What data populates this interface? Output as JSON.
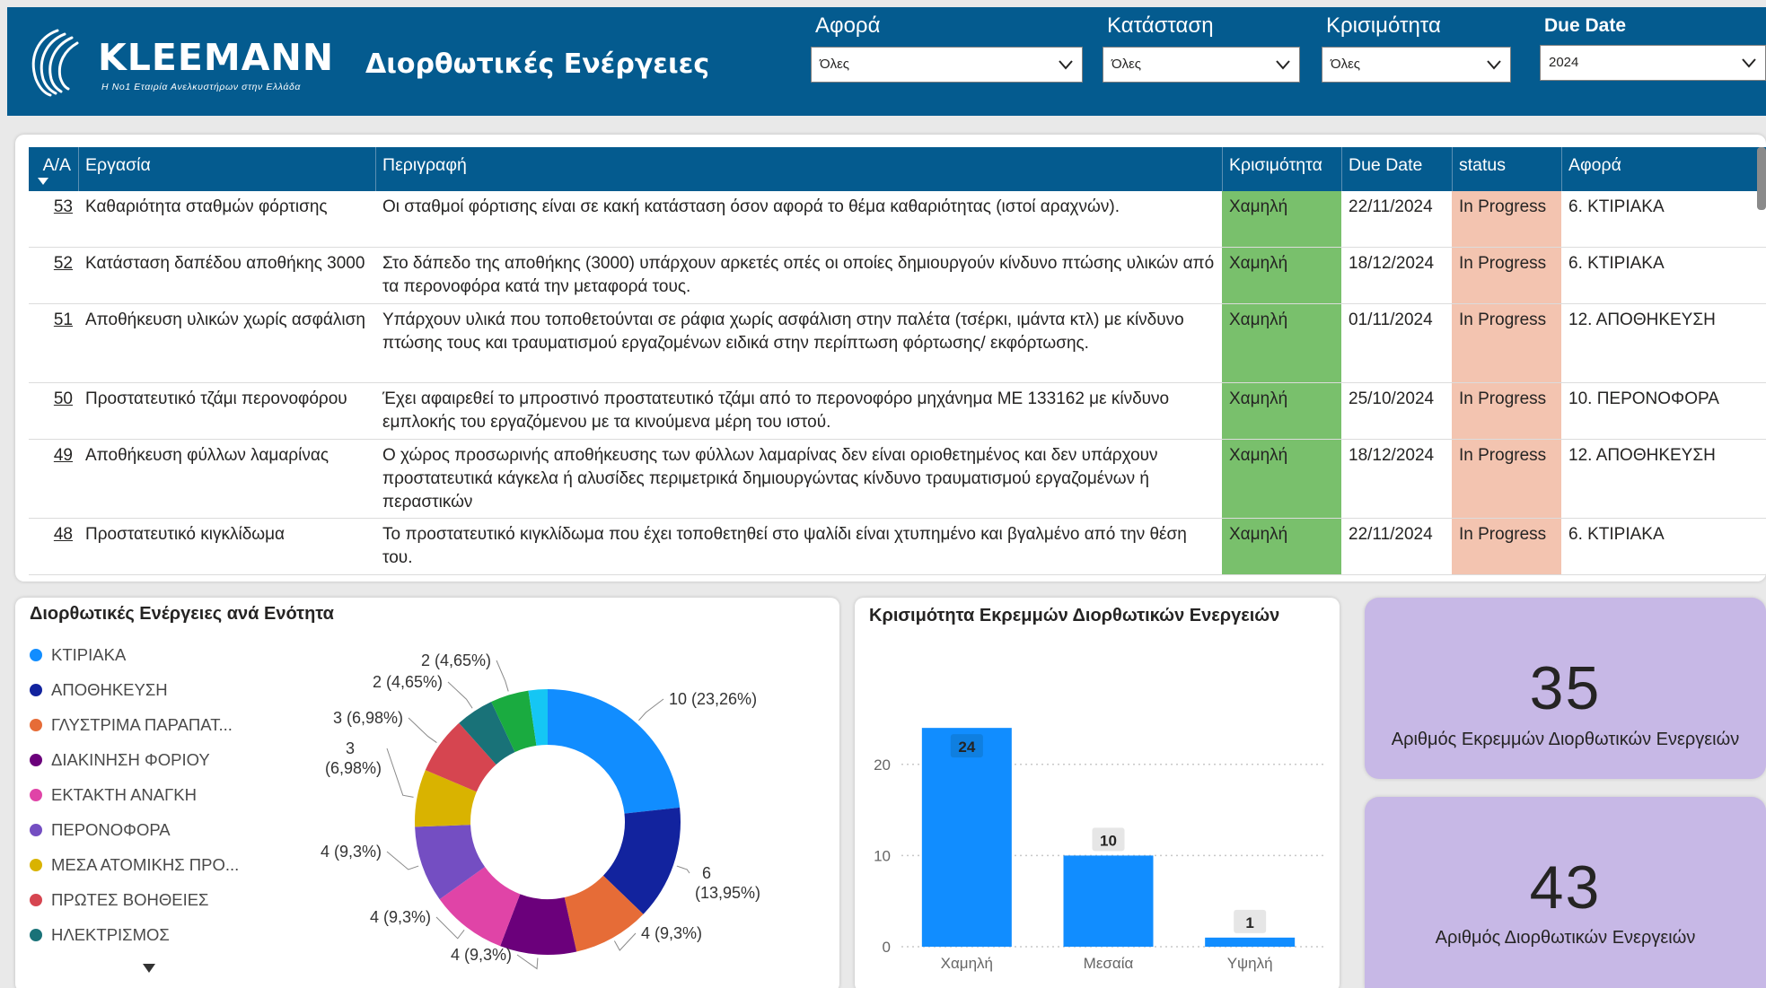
{
  "header": {
    "brand": "KLEEMANN",
    "tagline": "Η No1 Εταιρία Ανελκυστήρων στην Ελλάδα",
    "title": "Διορθωτικές Ενέργειες",
    "bg_color": "#045b8f"
  },
  "filters": [
    {
      "label": "Αφορά",
      "value": "Όλες"
    },
    {
      "label": "Κατάσταση",
      "value": "Όλες"
    },
    {
      "label": "Κρισιμότητα",
      "value": "Όλες"
    },
    {
      "label": "Due Date",
      "value": "2024"
    }
  ],
  "table": {
    "columns": [
      "A/A",
      "Εργασία",
      "Περιγραφή",
      "Κρισιμότητα",
      "Due Date",
      "status",
      "Αφορά"
    ],
    "rows": [
      {
        "aa": "53",
        "task": "Καθαριότητα σταθμών φόρτισης",
        "desc": "Οι σταθμοί φόρτισης είναι σε κακή κατάσταση όσον αφορά το θέμα καθαριότητας (ιστοί αραχνών).",
        "crit": "Χαμηλή",
        "due": "22/11/2024",
        "status": "In Progress",
        "about": "6. ΚΤΙΡΙΑΚΑ"
      },
      {
        "aa": "52",
        "task": "Κατάσταση δαπέδου αποθήκης 3000",
        "desc": "Στο δάπεδο της αποθήκης (3000) υπάρχουν αρκετές οπές οι οποίες δημιουργούν κίνδυνο πτώσης υλικών από τα περονοφόρα κατά την μεταφορά τους.",
        "crit": "Χαμηλή",
        "due": "18/12/2024",
        "status": "In Progress",
        "about": "6. ΚΤΙΡΙΑΚΑ"
      },
      {
        "aa": "51",
        "task": "Αποθήκευση υλικών χωρίς ασφάλιση",
        "desc": "Υπάρχουν υλικά που τοποθετούνται σε ράφια χωρίς ασφάλιση στην παλέτα (τσέρκι, ιμάντα κτλ) με κίνδυνο πτώσης τους και τραυματισμού εργαζομένων ειδικά στην περίπτωση φόρτωσης/ εκφόρτωσης.",
        "crit": "Χαμηλή",
        "due": "01/11/2024",
        "status": "In Progress",
        "about": "12. ΑΠΟΘΗΚΕΥΣΗ"
      },
      {
        "aa": "50",
        "task": "Προστατευτικό τζάμι περονοφόρου",
        "desc": "Έχει αφαιρεθεί το μπροστινό προστατευτικό τζάμι από το περονοφόρο μηχάνημα ΜΕ 133162 με κίνδυνο εμπλοκής του εργαζόμενου με τα κινούμενα μέρη του ιστού.",
        "crit": "Χαμηλή",
        "due": "25/10/2024",
        "status": "In Progress",
        "about": "10. ΠΕΡΟΝΟΦΟΡΑ"
      },
      {
        "aa": "49",
        "task": "Αποθήκευση φύλλων λαμαρίνας",
        "desc": "Ο χώρος προσωρινής αποθήκευσης των φύλλων λαμαρίνας δεν είναι οριοθετημένος και δεν υπάρχουν προστατευτικά κάγκελα ή αλυσίδες περιμετρικά δημιουργώντας κίνδυνο τραυματισμού εργαζομένων ή περαστικών",
        "crit": "Χαμηλή",
        "due": "18/12/2024",
        "status": "In Progress",
        "about": "12. ΑΠΟΘΗΚΕΥΣΗ"
      },
      {
        "aa": "48",
        "task": "Προστατευτικό κιγκλίδωμα",
        "desc": "Το προστατευτικό κιγκλίδωμα που έχει τοποθετηθεί στο ψαλίδι είναι χτυπημένο και βγαλμένο από την θέση του.",
        "crit": "Χαμηλή",
        "due": "22/11/2024",
        "status": "In Progress",
        "about": "6. ΚΤΙΡΙΑΚΑ"
      }
    ],
    "crit_color": "#79c06c",
    "status_color": "#f3c4b0"
  },
  "donut": {
    "title": "Διορθωτικές Ενέργειες ανά Ενότητα",
    "legend": [
      {
        "label": "ΚΤΙΡΙΑΚΑ",
        "color": "#118dff"
      },
      {
        "label": "ΑΠΟΘΗΚΕΥΣΗ",
        "color": "#12239e"
      },
      {
        "label": "ΓΛΥΣΤΡΙΜΑ ΠΑΡΑΠΑΤ...",
        "color": "#e66c37"
      },
      {
        "label": "ΔΙΑΚΙΝΗΣΗ ΦΟΡΙΟΥ",
        "color": "#6b007b"
      },
      {
        "label": "ΕΚΤΑΚΤΗ ΑΝΑΓΚΗ",
        "color": "#e044a7"
      },
      {
        "label": "ΠΕΡΟΝΟΦΟΡΑ",
        "color": "#744ec2"
      },
      {
        "label": "ΜΕΣΑ ΑΤΟΜΙΚΗΣ ΠΡΟ...",
        "color": "#d9b300"
      },
      {
        "label": "ΠΡΩΤΕΣ ΒΟΗΘΕΙΕΣ",
        "color": "#d64550"
      },
      {
        "label": "ΗΛΕΚΤΡΙΣΜΟΣ",
        "color": "#197278"
      }
    ]
  },
  "bar": {
    "title": "Κρισιμότητα Εκρεμμών Διορθωτικών Ενεργειών"
  },
  "chart_data": [
    {
      "type": "pie",
      "title": "Διορθωτικές Ενέργειες ανά Ενότητα",
      "slices": [
        {
          "label": "ΚΤΙΡΙΑΚΑ",
          "value": 10,
          "text": "10 (23,26%)",
          "color": "#118dff"
        },
        {
          "label": "ΑΠΟΘΗΚΕΥΣΗ",
          "value": 6,
          "text": "6 (13,95%)",
          "color": "#12239e"
        },
        {
          "label": "ΓΛΥΣΤΡΙΜΑ ΠΑΡΑΠΑΤ...",
          "value": 4,
          "text": "4 (9,3%)",
          "color": "#e66c37"
        },
        {
          "label": "ΔΙΑΚΙΝΗΣΗ ΦΟΡΙΟΥ",
          "value": 4,
          "text": "4 (9,3%)",
          "color": "#6b007b"
        },
        {
          "label": "ΕΚΤΑΚΤΗ ΑΝΑΓΚΗ",
          "value": 4,
          "text": "4 (9,3%)",
          "color": "#e044a7"
        },
        {
          "label": "ΠΕΡΟΝΟΦΟΡΑ",
          "value": 4,
          "text": "4 (9,3%)",
          "color": "#744ec2"
        },
        {
          "label": "ΜΕΣΑ ΑΤΟΜΙΚΗΣ ΠΡΟ...",
          "value": 3,
          "text": "3 (6,98%)",
          "color": "#d9b300"
        },
        {
          "label": "ΠΡΩΤΕΣ ΒΟΗΘΕΙΕΣ",
          "value": 3,
          "text": "3 (6,98%)",
          "color": "#d64550"
        },
        {
          "label": "ΗΛΕΚΤΡΙΣΜΟΣ",
          "value": 2,
          "text": "2 (4,65%)",
          "color": "#197278"
        },
        {
          "label": "",
          "value": 2,
          "text": "2 (4,65%)",
          "color": "#1aab40"
        },
        {
          "label": "",
          "value": 1,
          "text": "",
          "color": "#15c6f4"
        }
      ]
    },
    {
      "type": "bar",
      "title": "Κρισιμότητα Εκρεμμών Διορθωτικών Ενεργειών",
      "categories": [
        "Χαμηλή",
        "Μεσαία",
        "Υψηλή"
      ],
      "values": [
        24,
        10,
        1
      ],
      "yticks": [
        0,
        10,
        20
      ],
      "ylim": [
        0,
        25
      ],
      "grid": true,
      "color": "#118dff"
    }
  ],
  "kpis": [
    {
      "value": "35",
      "label": "Αριθμός Εκρεμμών Διορθωτικών Ενεργειών"
    },
    {
      "value": "43",
      "label": "Αριθμός Διορθωτικών Ενεργειών"
    }
  ]
}
